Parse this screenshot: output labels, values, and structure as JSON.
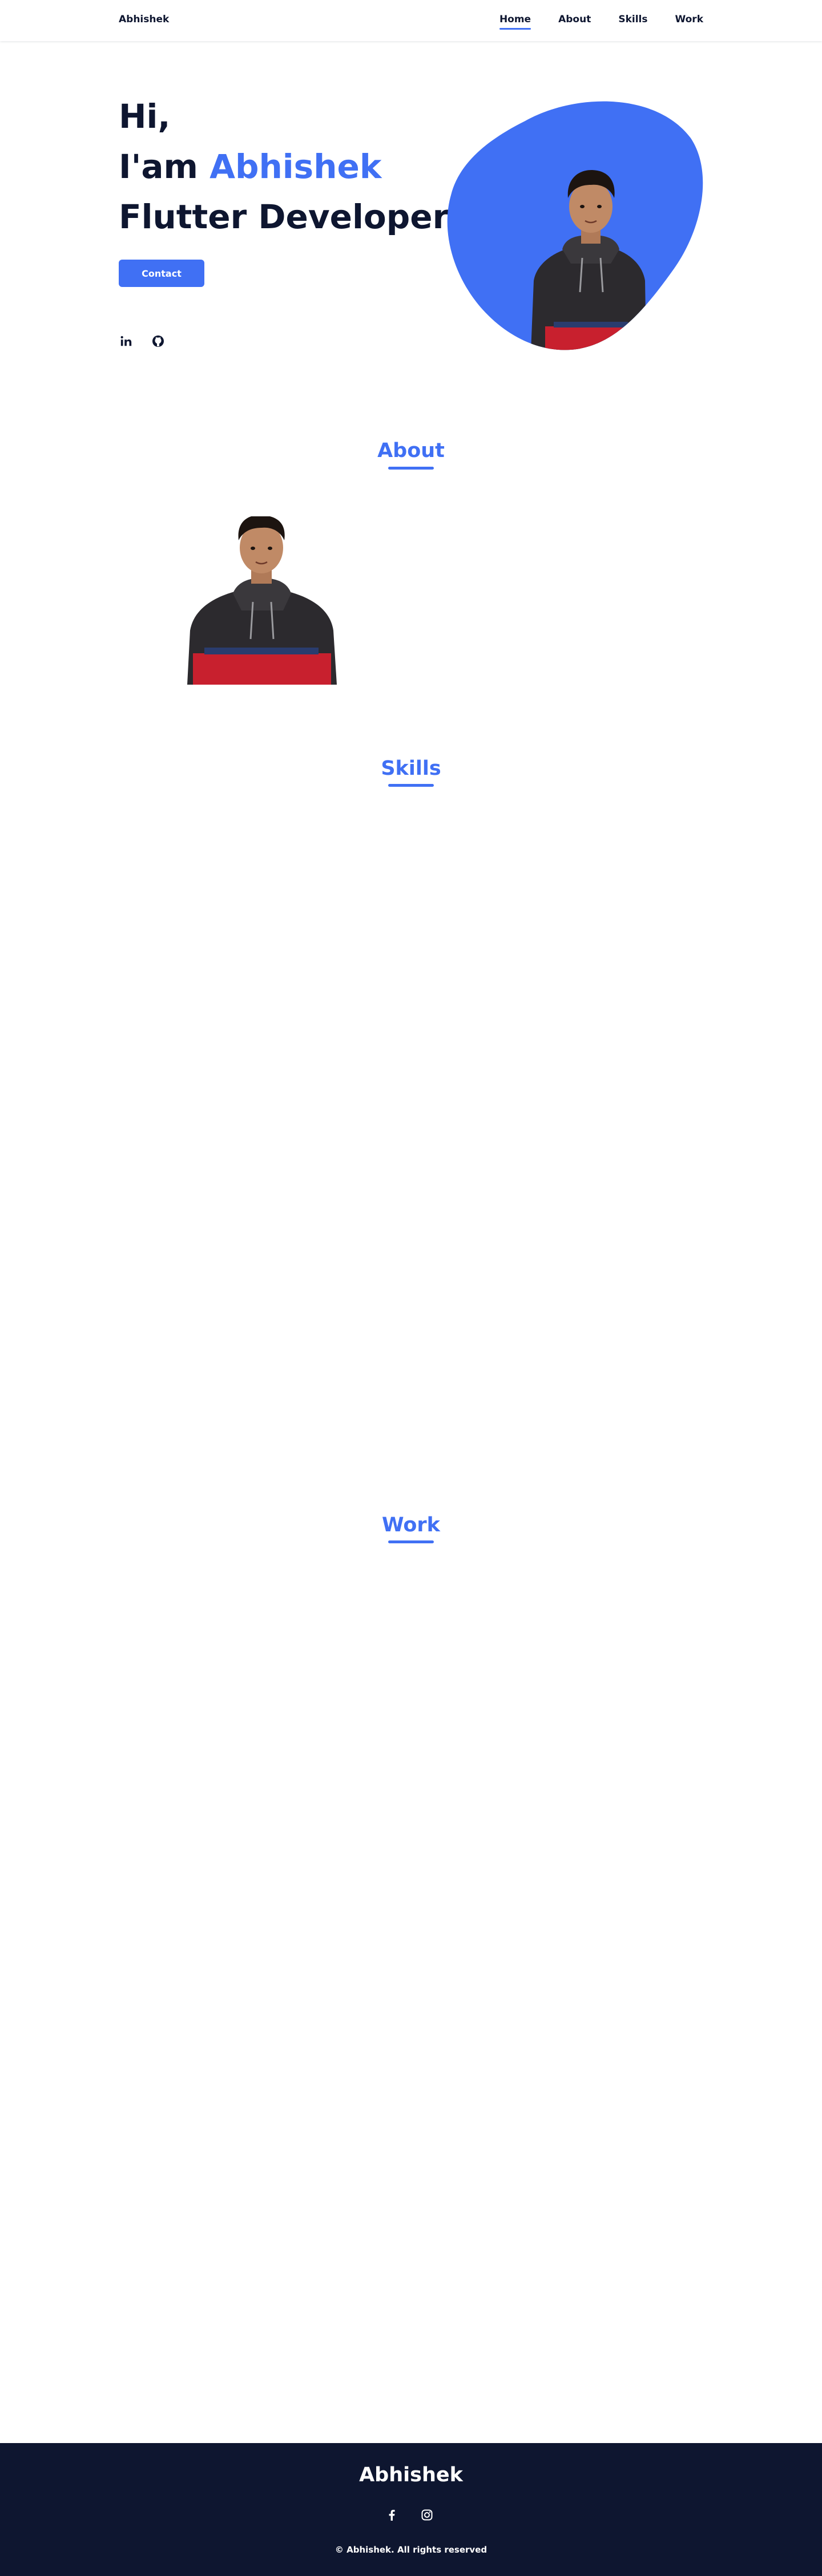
{
  "header": {
    "logo": "Abhishek",
    "nav": [
      "Home",
      "About",
      "Skills",
      "Work"
    ],
    "active_nav": "Home"
  },
  "hero": {
    "line1": "Hi,",
    "line2_prefix": "I'am ",
    "line2_name": "Abhishek",
    "line3": "Flutter Developer",
    "contact_label": "Contact",
    "social_icons": [
      "linkedin-icon",
      "github-icon"
    ]
  },
  "sections": {
    "about_title": "About",
    "skills_title": "Skills",
    "work_title": "Work"
  },
  "footer": {
    "title": "Abhishek",
    "social_icons": [
      "facebook-icon",
      "instagram-icon"
    ],
    "copyright": "© Abhishek. All rights reserved"
  },
  "colors": {
    "accent": "#4070f4",
    "dark": "#0e1630",
    "white": "#ffffff"
  }
}
